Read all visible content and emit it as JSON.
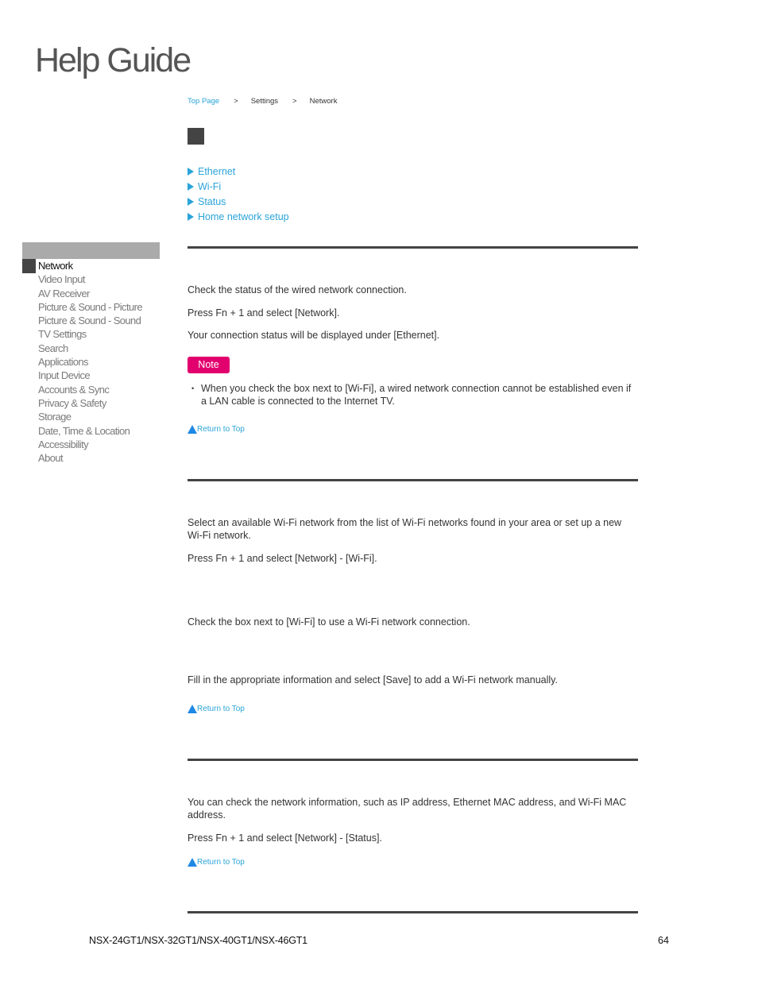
{
  "header": {
    "logo_text": "Help Guide"
  },
  "breadcrumb": {
    "items": [
      {
        "label": "Top Page",
        "link": true
      },
      {
        "label": "Settings",
        "link": false
      },
      {
        "label": "Network",
        "link": false
      }
    ],
    "separator": ">"
  },
  "toc": {
    "items": [
      {
        "label": "Ethernet",
        "icon": "triangle-right-icon"
      },
      {
        "label": "Wi-Fi",
        "icon": "triangle-right-icon"
      },
      {
        "label": "Status",
        "icon": "triangle-right-icon"
      },
      {
        "label": "Home network setup",
        "icon": "triangle-right-icon"
      }
    ]
  },
  "sidebar": {
    "items": [
      {
        "label": "Network",
        "active": true
      },
      {
        "label": "Video Input",
        "active": false
      },
      {
        "label": "AV Receiver",
        "active": false
      },
      {
        "label": "Picture & Sound - Picture",
        "active": false
      },
      {
        "label": "Picture & Sound - Sound",
        "active": false
      },
      {
        "label": "TV Settings",
        "active": false
      },
      {
        "label": "Search",
        "active": false
      },
      {
        "label": "Applications",
        "active": false
      },
      {
        "label": "Input Device",
        "active": false
      },
      {
        "label": "Accounts & Sync",
        "active": false
      },
      {
        "label": "Privacy & Safety",
        "active": false
      },
      {
        "label": "Storage",
        "active": false
      },
      {
        "label": "Date, Time & Location",
        "active": false
      },
      {
        "label": "Accessibility",
        "active": false
      },
      {
        "label": "About",
        "active": false
      }
    ]
  },
  "sections": {
    "ethernet": {
      "paragraphs": [
        "Check the status of the wired network connection.",
        "Press Fn + 1 and select [Network].",
        "Your connection status will be displayed under [Ethernet]."
      ],
      "note_label": "Note",
      "note_bullet": "•",
      "note_items": [
        "When you check the box next to [Wi-Fi], a wired network connection cannot be established even if a LAN cable is connected to the Internet TV."
      ],
      "return_to_top": "Return to Top"
    },
    "wifi": {
      "paragraphs": [
        "Select an available Wi-Fi network from the list of Wi-Fi networks found in your area or set up a new Wi-Fi network.",
        "Press Fn + 1 and select [Network] - [Wi-Fi].",
        "Check the box next to [Wi-Fi] to use a Wi-Fi network connection.",
        "Fill in the appropriate information and select [Save] to add a Wi-Fi network manually."
      ],
      "return_to_top": "Return to Top"
    },
    "status": {
      "paragraphs": [
        "You can check the network information, such as IP address, Ethernet MAC address, and Wi-Fi MAC address.",
        "Press Fn + 1 and select [Network] - [Status]."
      ],
      "return_to_top": "Return to Top"
    }
  },
  "footer": {
    "model": "NSX-24GT1/NSX-32GT1/NSX-40GT1/NSX-46GT1",
    "page_number": "64"
  },
  "colors": {
    "link": "#2aa4d8",
    "note_badge": "#e2006e",
    "rule": "#444444",
    "sidebar_header": "#aaaaaa"
  }
}
